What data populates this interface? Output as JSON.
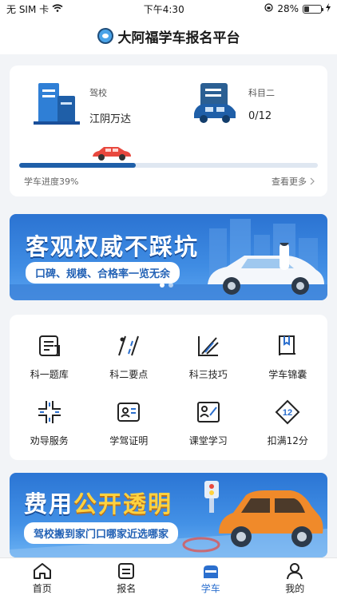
{
  "status_bar": {
    "carrier": "无 SIM 卡",
    "time": "下午4:30",
    "battery": "28%",
    "battery_level": 0.28
  },
  "header": {
    "title": "大阿福学车报名平台"
  },
  "progress_card": {
    "school_label": "驾校",
    "school_value": "江阴万达",
    "subject_label": "科目二",
    "subject_value": "0/12",
    "progress_text": "学车进度39%",
    "progress_value": 0.39,
    "more_text": "查看更多"
  },
  "banner1": {
    "headline": "客观权威不踩坑",
    "subtitle": "口碑、规模、合格率一览无余",
    "slide_count": 2,
    "active_slide": 0
  },
  "grid": {
    "items": [
      {
        "label": "科一题库",
        "icon": "question-bank-icon"
      },
      {
        "label": "科二要点",
        "icon": "road-points-icon"
      },
      {
        "label": "科三技巧",
        "icon": "road-skill-icon"
      },
      {
        "label": "学车锦囊",
        "icon": "book-icon"
      },
      {
        "label": "劝导服务",
        "icon": "crossroad-icon"
      },
      {
        "label": "学驾证明",
        "icon": "id-card-icon"
      },
      {
        "label": "课堂学习",
        "icon": "classroom-icon"
      },
      {
        "label": "扣满12分",
        "icon": "twelve-points-icon"
      }
    ]
  },
  "banner2": {
    "headline_white": "费用",
    "headline_yellow": "公开透明",
    "subtitle": "驾校搬到家门口哪家近选哪家"
  },
  "tabbar": {
    "tabs": [
      {
        "label": "首页",
        "icon": "home-icon"
      },
      {
        "label": "报名",
        "icon": "register-icon"
      },
      {
        "label": "学车",
        "icon": "car-icon"
      },
      {
        "label": "我的",
        "icon": "profile-icon"
      }
    ],
    "active_index": 2
  },
  "colors": {
    "primary": "#1f5fa8",
    "accent_blue": "#2b6fce",
    "banner_yellow": "#ffd23f",
    "car_red": "#e8483e",
    "car_orange": "#f08a2a"
  }
}
